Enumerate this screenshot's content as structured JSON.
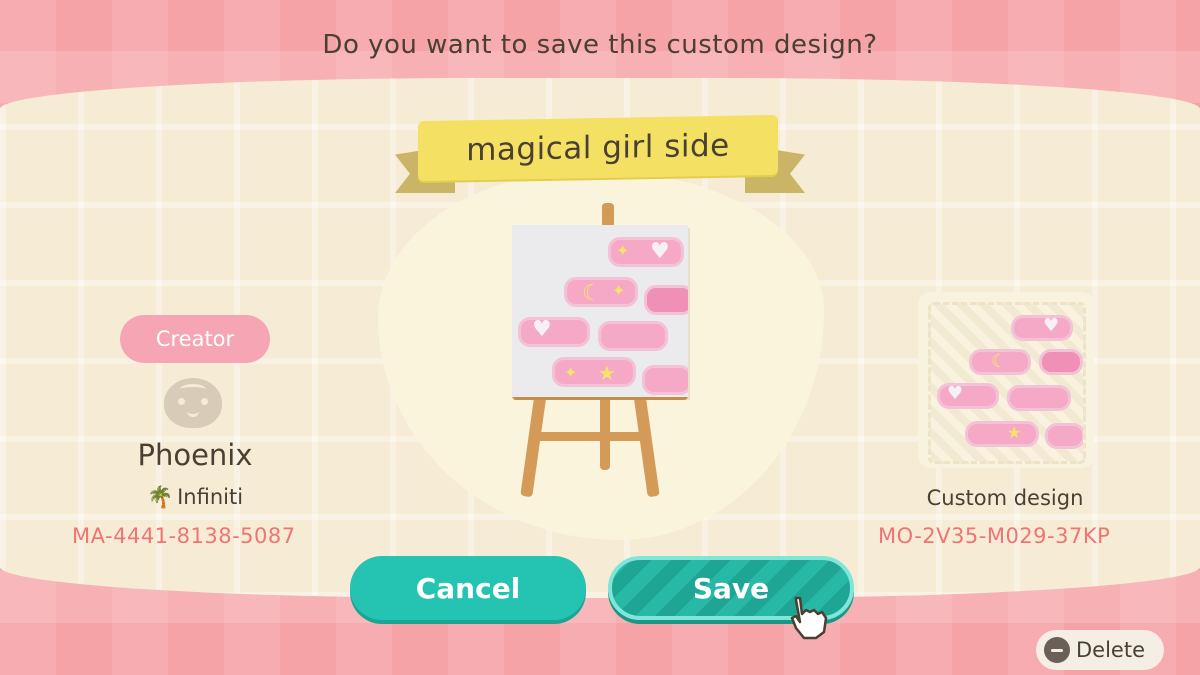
{
  "dialog": {
    "question": "Do you want to save this custom design?",
    "design_title": "magical girl side"
  },
  "creator": {
    "badge": "Creator",
    "name": "Phoenix",
    "island": "Infiniti",
    "creator_code": "MA-4441-8138-5087"
  },
  "design": {
    "type_label": "Custom design",
    "design_code": "MO-2V35-M029-37KP"
  },
  "buttons": {
    "cancel": "Cancel",
    "save": "Save",
    "delete": "Delete"
  },
  "icons": {
    "avatar": "villager-face-icon",
    "island": "palm-tree-icon",
    "pointer": "pointing-hand-cursor-icon",
    "delete": "minus-button-icon"
  },
  "colors": {
    "accent_teal": "#25c3b1",
    "code_red": "#f07474",
    "ribbon_yellow": "#f4e163",
    "background_pink": "#f5a3a7",
    "panel_cream": "#f6ecd6"
  }
}
